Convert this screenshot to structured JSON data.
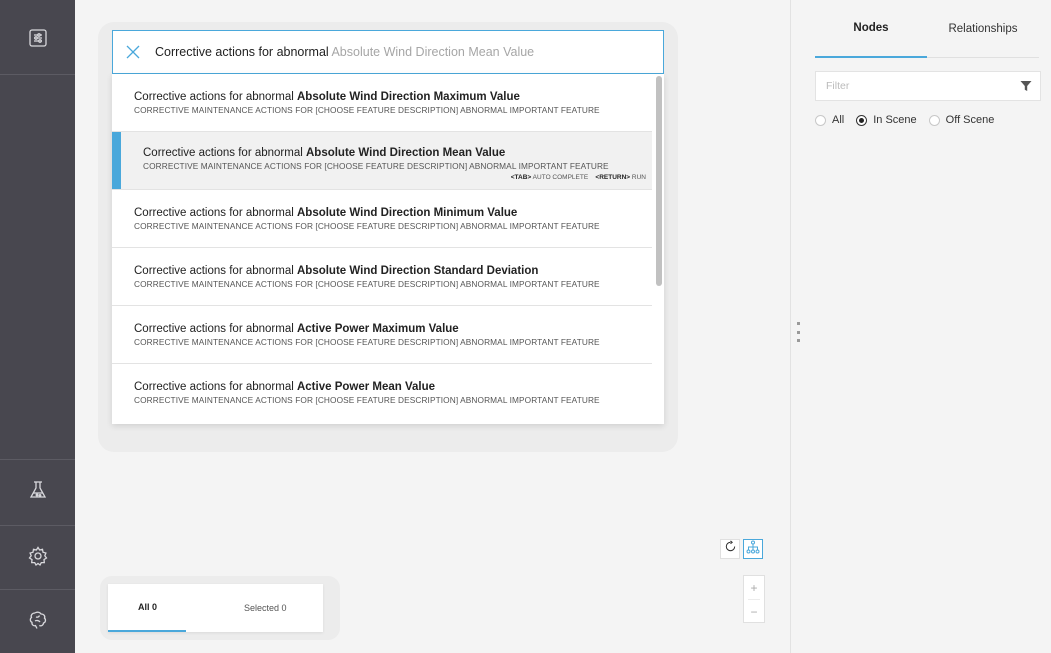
{
  "sidebar": {
    "icons": [
      "query-panel-icon",
      "flask-icon",
      "gear-icon",
      "brain-icon"
    ]
  },
  "search": {
    "query": "Corrective actions for abnormal",
    "autocomplete": " Absolute Wind Direction Mean Value"
  },
  "suggestions": [
    {
      "prefix": "Corrective actions for abnormal ",
      "bold": "Absolute Wind Direction Maximum Value",
      "subtitle": "CORRECTIVE MAINTENANCE ACTIONS FOR [CHOOSE FEATURE DESCRIPTION] ABNORMAL IMPORTANT FEATURE"
    },
    {
      "prefix": "Corrective actions for abnormal ",
      "bold": "Absolute Wind Direction Mean Value",
      "subtitle": "CORRECTIVE MAINTENANCE ACTIONS FOR [CHOOSE FEATURE DESCRIPTION] ABNORMAL IMPORTANT FEATURE"
    },
    {
      "prefix": "Corrective actions for abnormal ",
      "bold": "Absolute Wind Direction Minimum Value",
      "subtitle": "CORRECTIVE MAINTENANCE ACTIONS FOR [CHOOSE FEATURE DESCRIPTION] ABNORMAL IMPORTANT FEATURE"
    },
    {
      "prefix": "Corrective actions for abnormal ",
      "bold": "Absolute Wind Direction Standard Deviation",
      "subtitle": "CORRECTIVE MAINTENANCE ACTIONS FOR [CHOOSE FEATURE DESCRIPTION] ABNORMAL IMPORTANT FEATURE"
    },
    {
      "prefix": "Corrective actions for abnormal ",
      "bold": "Active Power Maximum Value",
      "subtitle": "CORRECTIVE MAINTENANCE ACTIONS FOR [CHOOSE FEATURE DESCRIPTION] ABNORMAL IMPORTANT FEATURE"
    },
    {
      "prefix": "Corrective actions for abnormal ",
      "bold": "Active Power Mean Value",
      "subtitle": "CORRECTIVE MAINTENANCE ACTIONS FOR [CHOOSE FEATURE DESCRIPTION] ABNORMAL IMPORTANT FEATURE"
    }
  ],
  "hint": {
    "tab_key": "<TAB>",
    "tab_text": " AUTO COMPLETE",
    "return_key": "<RETURN>",
    "return_text": " RUN"
  },
  "bottom_tabs": {
    "all": "All 0",
    "selected": "Selected 0"
  },
  "zoom": {
    "plus": "+",
    "minus": "−"
  },
  "panel": {
    "tab_nodes": "Nodes",
    "tab_relationships": "Relationships",
    "filter_placeholder": "Filter",
    "radio_all": "All",
    "radio_in_scene": "In Scene",
    "radio_off_scene": "Off Scene",
    "selected_radio": "In Scene"
  },
  "colors": {
    "accent": "#4aa8db",
    "sidebar": "#48474f"
  }
}
